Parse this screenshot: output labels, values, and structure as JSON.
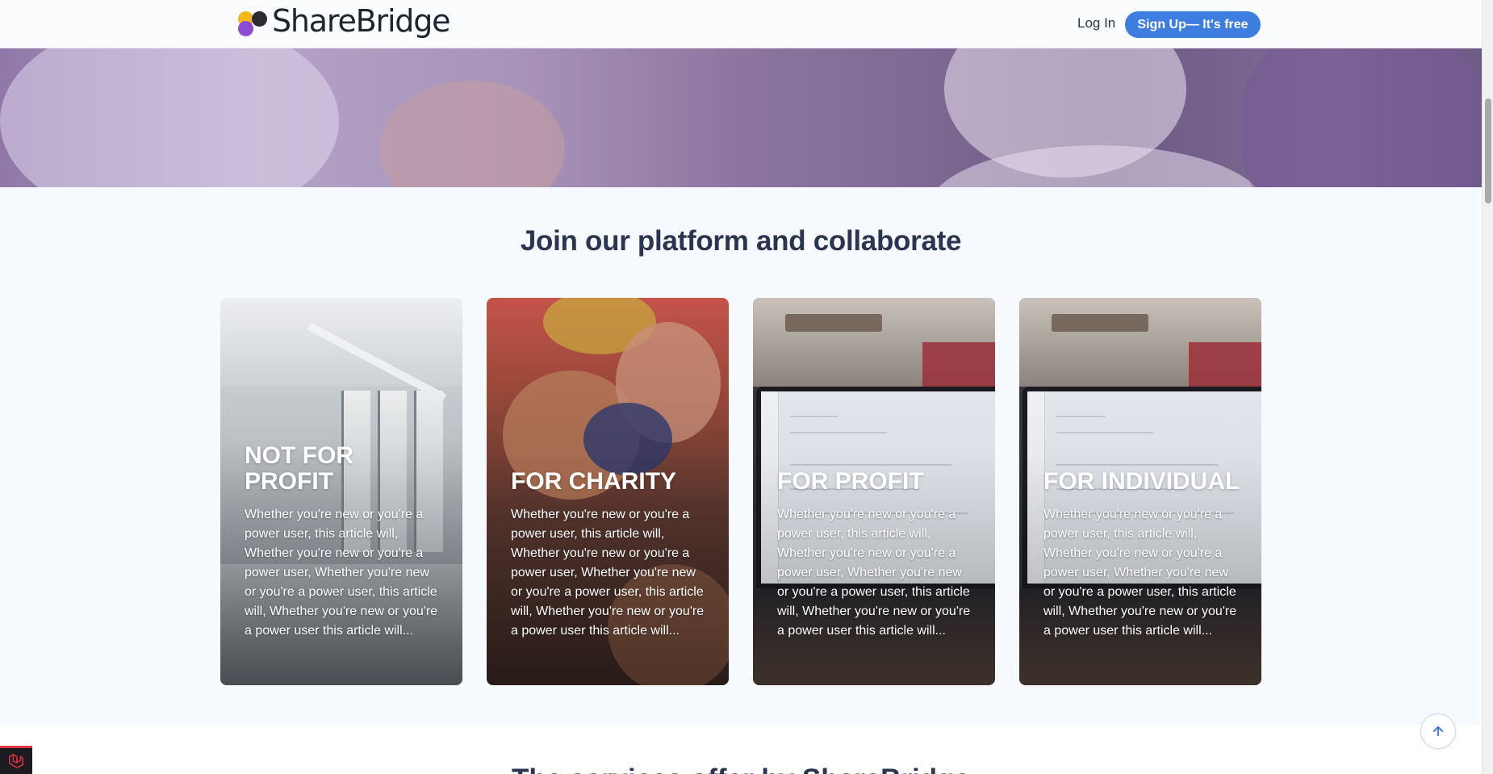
{
  "header": {
    "brand": "ShareBridge",
    "login_label": "Log In",
    "signup_label": "Sign Up— It's free"
  },
  "section": {
    "title": "Join our platform and collaborate"
  },
  "cards": [
    {
      "title": "NOT FOR PROFIT",
      "text": "Whether you're new or you're a power user, this article will, Whether you're new or you're a power user, Whether you're new or you're a power user, this article will, Whether you're new or you're a power user this article will..."
    },
    {
      "title": "FOR CHARITY",
      "text": "Whether you're new or you're a power user, this article will, Whether you're new or you're a power user, Whether you're new or you're a power user, this article will, Whether you're new or you're a power user this article will..."
    },
    {
      "title": "FOR PROFIT",
      "text": "Whether you're new or you're a power user, this article will, Whether you're new or you're a power user, Whether you're new or you're a power user, this article will, Whether you're new or you're a power user this article will..."
    },
    {
      "title": "FOR INDIVIDUAL",
      "text": "Whether you're new or you're a power user, this article will, Whether you're new or you're a power user, Whether you're new or you're a power user, this article will, Whether you're new or you're a power user this article will..."
    }
  ],
  "next_section": {
    "title": "The services offer by ShareBridge"
  },
  "icons": {
    "scroll_top": "arrow-up-icon",
    "corner": "laravel-icon"
  },
  "colors": {
    "accent": "#3d7ee0",
    "heading": "#2b3550",
    "background": "#f6f9fd"
  }
}
